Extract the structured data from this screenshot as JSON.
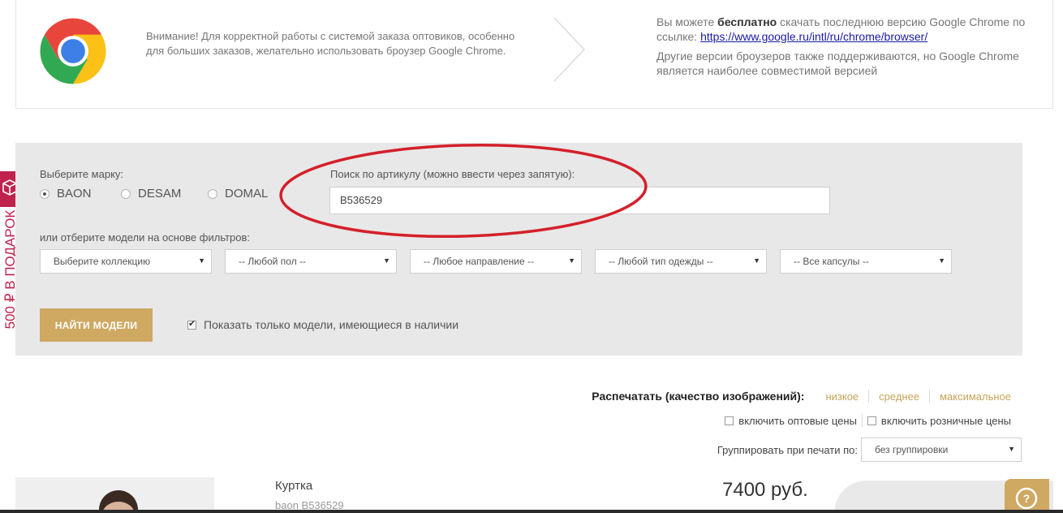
{
  "banner": {
    "warning_text": "Внимание! Для корректной работы с системой заказа оптовиков, особенно для больших заказов, желательно использовать броузер Google Chrome.",
    "download_prefix": "Вы можете ",
    "download_bold": "бесплатно",
    "download_mid": " скачать последнюю версию Google Chrome по ссылке: ",
    "download_link": "https://www.google.ru/intl/ru/chrome/browser/",
    "other_browsers_text": "Другие версии броузеров также поддерживаются, но Google Chrome является наиболее совместимой версией"
  },
  "side_promo": {
    "text": "500 ₽ В ПОДАРОК",
    "color": "#c0224e"
  },
  "filters": {
    "brand_label": "Выберите марку:",
    "brands": [
      {
        "label": "BAON",
        "checked": true
      },
      {
        "label": "DESAM",
        "checked": false
      },
      {
        "label": "DOMAL",
        "checked": false
      }
    ],
    "search_label": "Поиск по артикулу (можно ввести через запятую):",
    "search_value": "B536529",
    "filter_label": "или отберите модели на основе фильтров:",
    "selects": [
      "Выберите коллекцию",
      "-- Любой пол --",
      "-- Любое направление --",
      "-- Любой тип одежды --",
      "-- Все капсулы --"
    ],
    "find_button": "НАЙТИ МОДЕЛИ",
    "in_stock_label": "Показать только модели, имеющиеся в наличии",
    "in_stock_checked": true
  },
  "print": {
    "label": "Распечатать (качество изображений):",
    "qualities": [
      "низкое",
      "среднее",
      "максимальное"
    ],
    "wholesale_label": "включить оптовые цены",
    "retail_label": "включить розничные цены",
    "group_label": "Группировать при печати по:",
    "group_value": "без группировки"
  },
  "product": {
    "name": "Куртка",
    "sku": "baon B536529",
    "price": "7400 руб."
  },
  "colors": {
    "accent": "#cfa862",
    "panel": "#e8e8e8",
    "promo": "#c0224e",
    "annotation": "#d4202a"
  }
}
